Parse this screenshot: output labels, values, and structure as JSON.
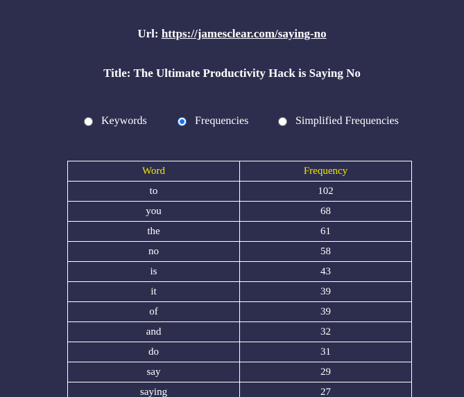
{
  "header": {
    "url_label": "Url:",
    "url": "https://jamesclear.com/saying-no",
    "title_label": "Title:",
    "title": "The Ultimate Productivity Hack is Saying No"
  },
  "view_options": [
    {
      "label": "Keywords",
      "checked": false
    },
    {
      "label": "Frequencies",
      "checked": true
    },
    {
      "label": "Simplified Frequencies",
      "checked": false
    }
  ],
  "table": {
    "columns": [
      "Word",
      "Frequency"
    ],
    "rows": [
      [
        "to",
        "102"
      ],
      [
        "you",
        "68"
      ],
      [
        "the",
        "61"
      ],
      [
        "no",
        "58"
      ],
      [
        "is",
        "43"
      ],
      [
        "it",
        "39"
      ],
      [
        "of",
        "39"
      ],
      [
        "and",
        "32"
      ],
      [
        "do",
        "31"
      ],
      [
        "say",
        "29"
      ],
      [
        "saying",
        "27"
      ]
    ]
  },
  "colors": {
    "background": "#2d2e4e",
    "header_text": "#f2e600",
    "radio_accent": "#1a73e8"
  }
}
